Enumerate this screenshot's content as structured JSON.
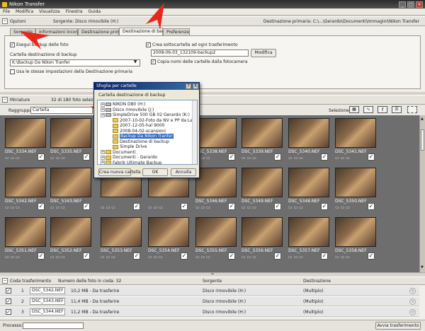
{
  "window": {
    "title": "Nikon Transfer"
  },
  "menu": [
    "File",
    "Modifica",
    "Visualizza",
    "Finestra",
    "Guida"
  ],
  "options": {
    "section_label": "Opzioni",
    "source_label": "Sorgente: Disco rimovibile (H:)",
    "dest_label": "Destinazione primaria: C:\\...\\Gerardo\\Documenti\\Immagini\\Nikon Transfer",
    "tabs": [
      "Sorgente",
      "Informazioni incorporate",
      "Destinazione primaria",
      "Destinazione di backup",
      "Preferenze"
    ],
    "backup_checkbox": "Esegui backup delle foto",
    "backup_folder_label": "Cartella destinazione di backup",
    "backup_folder_value": "K:\\Backup Da Nikon Tranfer",
    "same_settings": "Usa le stesse impostazioni della Destinazione primaria",
    "create_subfolder": "Crea sottocartella ad ogni trasferimento",
    "subfolder_value": "2008-06-03_132109-backup2",
    "modify_button": "Modifica",
    "copy_folder_names": "Copia nomi delle cartelle dalla fotocamera"
  },
  "thumbnails": {
    "section_label": "Miniature",
    "count_label": "32 di 180 foto selezionate",
    "group_label": "Raggruppa:",
    "group_value": "Cartella",
    "selection_label": "Selezione:",
    "rows": [
      [
        "DSC_5334.NEF",
        "DSC_5335.NEF",
        "",
        "",
        "DSC_5338.NEF",
        "DSC_5339.NEF",
        "DSC_5340.NEF",
        "DSC_5341.NEF"
      ],
      [
        "DSC_5342.NEF",
        "DSC_5343.NEF",
        "",
        "",
        "DSC_5346.NEF",
        "DSC_5349.NEF",
        "DSC_5348.NEF",
        "DSC_5350.NEF"
      ],
      [
        "DSC_5351.NEF",
        "DSC_5352.NEF",
        "DSC_5353.NEF",
        "DSC_5354.NEF",
        "DSC_5355.NEF",
        "DSC_5356.NEF",
        "DSC_5357.NEF",
        "DSC_5358.NEF"
      ]
    ]
  },
  "dialog": {
    "title": "Sfoglia per cartelle",
    "help_btn": "?",
    "close_btn": "X",
    "caption": "Cartella destinazione di backup",
    "tree": [
      {
        "label": "NIKON D80 (H:)",
        "level": 0,
        "icon": "drive"
      },
      {
        "label": "Disco rimovibile (J:)",
        "level": 0,
        "icon": "drive"
      },
      {
        "label": "SimpleDrive 500 GB 02 Gerardo (K:)",
        "level": 0,
        "icon": "drive"
      },
      {
        "label": "2007-10-02-Foto da NV e PP da Lacie 9",
        "level": 1,
        "icon": "folder"
      },
      {
        "label": "2007-12-05-hal 9000",
        "level": 1,
        "icon": "folder"
      },
      {
        "label": "2008-04-02-scansioni",
        "level": 1,
        "icon": "folder"
      },
      {
        "label": "Backup Da Nikon Tranfer",
        "level": 1,
        "icon": "folder",
        "selected": true
      },
      {
        "label": "Destinazione di backup",
        "level": 1,
        "icon": "folder"
      },
      {
        "label": "Simple Drive",
        "level": 1,
        "icon": "folder"
      },
      {
        "label": "Documenti",
        "level": 0,
        "icon": "folder"
      },
      {
        "label": "Documenti - Gerardo",
        "level": 0,
        "icon": "folder"
      },
      {
        "label": "Fabrik Ultimate Backup",
        "level": 0,
        "icon": "folder"
      }
    ],
    "new_folder_btn": "Crea nuova cartella",
    "ok_btn": "OK",
    "cancel_btn": "Annulla"
  },
  "queue": {
    "section_label": "Coda trasferimento",
    "count_label": "Numero delle foto in coda: 32",
    "col_source": "Sorgente",
    "col_dest": "Destinazione",
    "rows": [
      {
        "num": "1",
        "file": "DSC_5342.NEF",
        "size": "10,2 MB - Da trasferire",
        "source": "Disco rimovibile (H:)",
        "dest": "(Multiplo)"
      },
      {
        "num": "2",
        "file": "DSC_5343.NEF",
        "size": "11,4 MB - Da trasferire",
        "source": "Disco rimovibile (H:)",
        "dest": "(Multiplo)"
      },
      {
        "num": "3",
        "file": "DSC_5344.NEF",
        "size": "11,2 MB - Da trasferire",
        "source": "Disco rimovibile (H:)",
        "dest": "(Multiplo)"
      }
    ]
  },
  "status": {
    "process_label": "Processo:",
    "start_button": "Avvia trasferimento"
  },
  "colors": {
    "accent_red": "#e8271c",
    "selection_blue": "#316ac5",
    "titlebar": "#3a3a3a"
  }
}
